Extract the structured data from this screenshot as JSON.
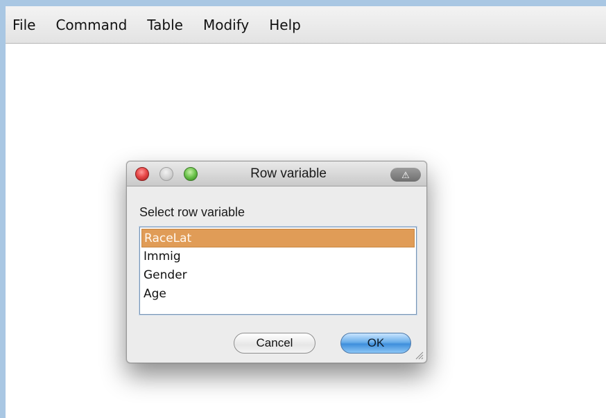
{
  "menubar": {
    "items": [
      {
        "label": "File"
      },
      {
        "label": "Command"
      },
      {
        "label": "Table"
      },
      {
        "label": "Modify"
      },
      {
        "label": "Help"
      }
    ]
  },
  "dialog": {
    "title": "Row variable",
    "toolbar_icon": "warning-icon",
    "prompt": "Select row variable",
    "list": {
      "selected_index": 0,
      "items": [
        "RaceLat",
        "Immig",
        "Gender",
        "Age"
      ]
    },
    "buttons": {
      "cancel_label": "Cancel",
      "ok_label": "OK"
    }
  },
  "colors": {
    "selection": "#e09c57",
    "ok_button": "#3f8fdc",
    "close_button": "#e84a4a",
    "zoom_button": "#6ac24a"
  }
}
